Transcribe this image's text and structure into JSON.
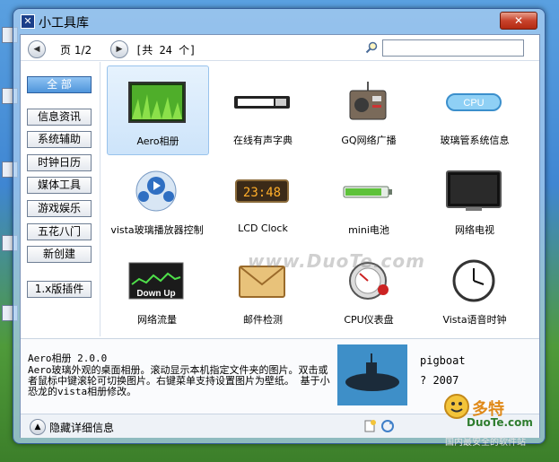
{
  "window": {
    "title": "小工具库",
    "close_symbol": "✕"
  },
  "toolbar": {
    "page": "页 1/2",
    "total": "[共 24 个]",
    "search_placeholder": ""
  },
  "sidebar": {
    "all_label": "全  部",
    "categories": [
      "信息资讯",
      "系统辅助",
      "时钟日历",
      "媒体工具",
      "游戏娱乐",
      "五花八门",
      "新创建"
    ],
    "legacy_label": "1.x版插件"
  },
  "gadgets": [
    {
      "label": "Aero相册",
      "icon": "photo-album-icon",
      "selected": true
    },
    {
      "label": "在线有声字典",
      "icon": "dictionary-icon"
    },
    {
      "label": "GQ网络广播",
      "icon": "radio-icon"
    },
    {
      "label": "玻璃管系统信息",
      "icon": "cpu-tube-icon"
    },
    {
      "label": "vista玻璃播放器控制",
      "icon": "media-player-icon"
    },
    {
      "label": "LCD Clock",
      "icon": "lcd-clock-icon"
    },
    {
      "label": "mini电池",
      "icon": "battery-icon"
    },
    {
      "label": "网络电视",
      "icon": "tv-icon"
    },
    {
      "label": "网络流量",
      "icon": "network-traffic-icon"
    },
    {
      "label": "邮件检测",
      "icon": "mail-icon"
    },
    {
      "label": "CPU仪表盘",
      "icon": "cpu-gauge-icon"
    },
    {
      "label": "Vista语音时钟",
      "icon": "analog-clock-icon"
    }
  ],
  "thumb_text": {
    "lcd": "23:48",
    "network": "Down Up",
    "cpu": "CPU"
  },
  "detail": {
    "title": "Aero相册 2.0.0",
    "description": "Aero玻璃外观的桌面相册。滚动显示本机指定文件夹的图片。双击或者鼠标中键滚轮可切换图片。右键菜单支持设置图片为壁纸。 基于小恐龙的vista相册修改。",
    "author": "pigboat",
    "year": "? 2007",
    "image": "submarine-icon"
  },
  "footer": {
    "toggle_label": "隐藏详细信息"
  },
  "overlay": {
    "watermark": "www.DuoTe.com",
    "brand_name": "多特",
    "brand_domain": "DuoTe.com",
    "brand_slogan": "国内最安全的软件站"
  }
}
